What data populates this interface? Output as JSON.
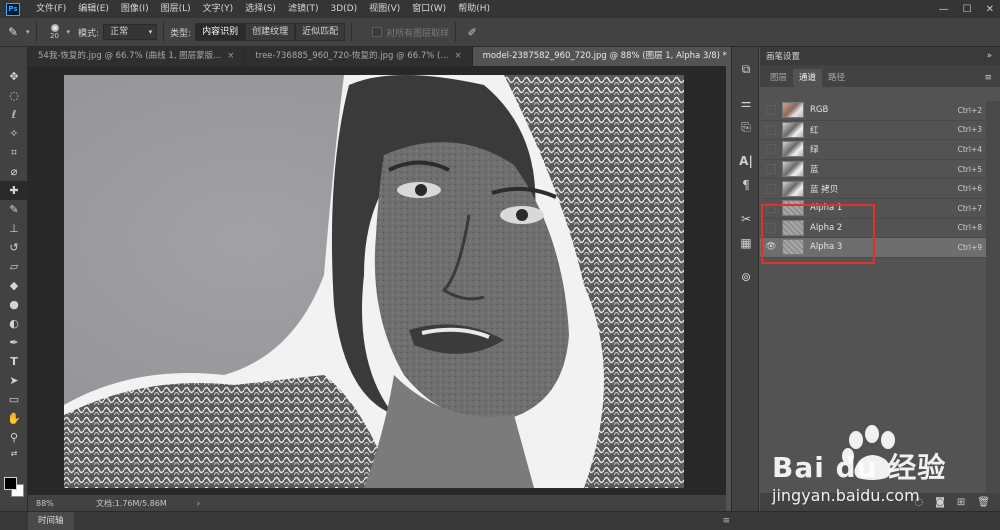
{
  "app": {
    "logo": "Ps"
  },
  "menu": [
    "文件(F)",
    "编辑(E)",
    "图像(I)",
    "图层(L)",
    "文字(Y)",
    "选择(S)",
    "滤镜(T)",
    "3D(D)",
    "视图(V)",
    "窗口(W)",
    "帮助(H)"
  ],
  "options": {
    "brush_size": "20",
    "mode_label": "模式:",
    "mode_value": "正常",
    "type_label": "类型:",
    "type_buttons": [
      "内容识别",
      "创建纹理",
      "近似匹配"
    ],
    "sample_all_layers": "对所有图层取样"
  },
  "tabs": [
    {
      "label": "54我-恢复的.jpg @ 66.7% (曲线 1, 图层蒙版...",
      "close": "×"
    },
    {
      "label": "tree-736885_960_720-恢复的.jpg @ 66.7% (...",
      "close": "×"
    },
    {
      "label": "model-2387582_960_720.jpg @ 88% (图层 1, Alpha 3/8) *",
      "close": "×"
    }
  ],
  "status": {
    "zoom": "88%",
    "doc_size": "文档:1.76M/5.86M",
    "arrow": "›"
  },
  "timeline": {
    "label": "时间轴"
  },
  "panel": {
    "header": "画笔设置",
    "tabs": [
      "图层",
      "通道",
      "路径"
    ],
    "channels": [
      {
        "name": "RGB",
        "shortcut": "Ctrl+2",
        "thumb": "color",
        "eye": false
      },
      {
        "name": "红",
        "shortcut": "Ctrl+3",
        "thumb": "gray",
        "eye": false
      },
      {
        "name": "绿",
        "shortcut": "Ctrl+4",
        "thumb": "gray",
        "eye": false
      },
      {
        "name": "蓝",
        "shortcut": "Ctrl+5",
        "thumb": "gray",
        "eye": false
      },
      {
        "name": "蓝 拷贝",
        "shortcut": "Ctrl+6",
        "thumb": "gray",
        "eye": false
      },
      {
        "name": "Alpha 1",
        "shortcut": "Ctrl+7",
        "thumb": "alpha",
        "eye": false
      },
      {
        "name": "Alpha 2",
        "shortcut": "Ctrl+8",
        "thumb": "alpha",
        "eye": false
      },
      {
        "name": "Alpha 3",
        "shortcut": "Ctrl+9",
        "thumb": "alpha",
        "eye": true
      }
    ]
  },
  "watermark": {
    "brand": "Bai du 经验",
    "url": "jingyan.baidu.com"
  },
  "colors": {
    "highlight": "#e0322b",
    "accent": "#31a8ff"
  }
}
